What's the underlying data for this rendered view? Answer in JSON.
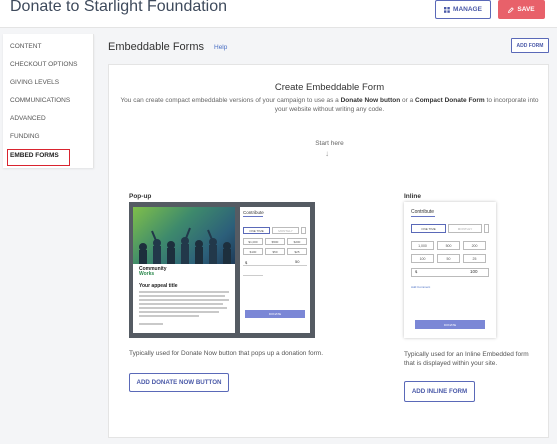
{
  "header": {
    "title": "Donate to Starlight Foundation",
    "manage_label": "MANAGE",
    "save_label": "SAVE"
  },
  "sidebar": {
    "items": [
      {
        "label": "CONTENT"
      },
      {
        "label": "CHECKOUT OPTIONS"
      },
      {
        "label": "GIVING LEVELS"
      },
      {
        "label": "COMMUNICATIONS"
      },
      {
        "label": "ADVANCED"
      },
      {
        "label": "FUNDING"
      },
      {
        "label": "EMBED FORMS",
        "active": true
      }
    ]
  },
  "main": {
    "title": "Embeddable Forms",
    "help_label": "Help",
    "add_form_label": "ADD FORM",
    "panel": {
      "title": "Create Embeddable Form",
      "desc_1": "You can create compact embeddable versions of your campaign to use as a ",
      "desc_b1": "Donate Now button",
      "desc_2": " or a ",
      "desc_b2": "Compact Donate Form",
      "desc_3": " to incorporate into your website without writing any code.",
      "start_here": "Start here"
    },
    "popup": {
      "label": "Pop-up",
      "caption": "Typically used for Donate Now button that pops up a donation form.",
      "button_label": "ADD DONATE NOW BUTTON",
      "preview": {
        "logo_line1": "Community",
        "logo_line2": "Works",
        "appeal_title": "Your appeal title",
        "form_title": "Contribute",
        "freq": [
          "ONE TIME",
          "MONTHLY"
        ],
        "amounts": [
          "$1,000",
          "$500",
          "$200",
          "$100",
          "$50",
          "$25"
        ],
        "custom_amount": "50",
        "donate_label": "DONATE"
      }
    },
    "inline": {
      "label": "Inline",
      "caption": "Typically used for an Inline Embedded form that is displayed within your site.",
      "button_label": "ADD INLINE FORM",
      "preview": {
        "form_title": "Contribute",
        "freq": [
          "ONE TIME",
          "MONTHLY"
        ],
        "amounts": [
          "1,000",
          "500",
          "200",
          "100",
          "50",
          "25"
        ],
        "custom_amount": "100",
        "comment_label": "Add Comment",
        "donate_label": "DONATE"
      }
    }
  },
  "colors": {
    "accent": "#5a69b8",
    "save": "#e8616a",
    "highlight": "#d9242f"
  }
}
